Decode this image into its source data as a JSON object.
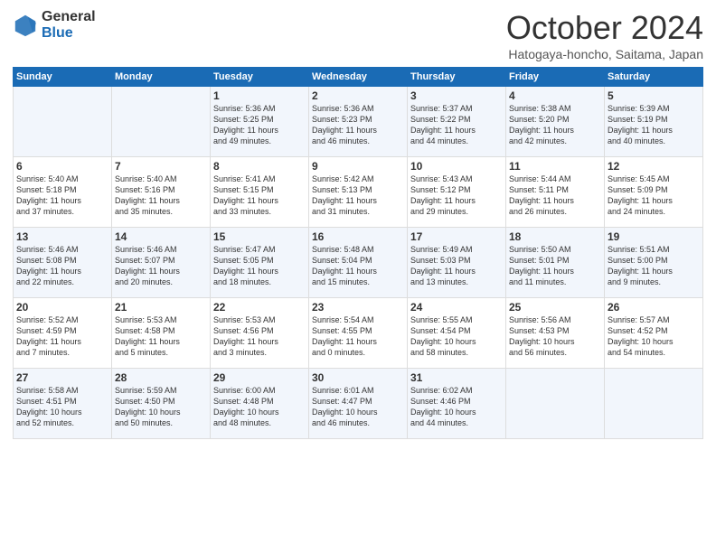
{
  "header": {
    "logo_general": "General",
    "logo_blue": "Blue",
    "title": "October 2024",
    "location": "Hatogaya-honcho, Saitama, Japan"
  },
  "days_of_week": [
    "Sunday",
    "Monday",
    "Tuesday",
    "Wednesday",
    "Thursday",
    "Friday",
    "Saturday"
  ],
  "weeks": [
    [
      {
        "day": "",
        "text": ""
      },
      {
        "day": "",
        "text": ""
      },
      {
        "day": "1",
        "text": "Sunrise: 5:36 AM\nSunset: 5:25 PM\nDaylight: 11 hours\nand 49 minutes."
      },
      {
        "day": "2",
        "text": "Sunrise: 5:36 AM\nSunset: 5:23 PM\nDaylight: 11 hours\nand 46 minutes."
      },
      {
        "day": "3",
        "text": "Sunrise: 5:37 AM\nSunset: 5:22 PM\nDaylight: 11 hours\nand 44 minutes."
      },
      {
        "day": "4",
        "text": "Sunrise: 5:38 AM\nSunset: 5:20 PM\nDaylight: 11 hours\nand 42 minutes."
      },
      {
        "day": "5",
        "text": "Sunrise: 5:39 AM\nSunset: 5:19 PM\nDaylight: 11 hours\nand 40 minutes."
      }
    ],
    [
      {
        "day": "6",
        "text": "Sunrise: 5:40 AM\nSunset: 5:18 PM\nDaylight: 11 hours\nand 37 minutes."
      },
      {
        "day": "7",
        "text": "Sunrise: 5:40 AM\nSunset: 5:16 PM\nDaylight: 11 hours\nand 35 minutes."
      },
      {
        "day": "8",
        "text": "Sunrise: 5:41 AM\nSunset: 5:15 PM\nDaylight: 11 hours\nand 33 minutes."
      },
      {
        "day": "9",
        "text": "Sunrise: 5:42 AM\nSunset: 5:13 PM\nDaylight: 11 hours\nand 31 minutes."
      },
      {
        "day": "10",
        "text": "Sunrise: 5:43 AM\nSunset: 5:12 PM\nDaylight: 11 hours\nand 29 minutes."
      },
      {
        "day": "11",
        "text": "Sunrise: 5:44 AM\nSunset: 5:11 PM\nDaylight: 11 hours\nand 26 minutes."
      },
      {
        "day": "12",
        "text": "Sunrise: 5:45 AM\nSunset: 5:09 PM\nDaylight: 11 hours\nand 24 minutes."
      }
    ],
    [
      {
        "day": "13",
        "text": "Sunrise: 5:46 AM\nSunset: 5:08 PM\nDaylight: 11 hours\nand 22 minutes."
      },
      {
        "day": "14",
        "text": "Sunrise: 5:46 AM\nSunset: 5:07 PM\nDaylight: 11 hours\nand 20 minutes."
      },
      {
        "day": "15",
        "text": "Sunrise: 5:47 AM\nSunset: 5:05 PM\nDaylight: 11 hours\nand 18 minutes."
      },
      {
        "day": "16",
        "text": "Sunrise: 5:48 AM\nSunset: 5:04 PM\nDaylight: 11 hours\nand 15 minutes."
      },
      {
        "day": "17",
        "text": "Sunrise: 5:49 AM\nSunset: 5:03 PM\nDaylight: 11 hours\nand 13 minutes."
      },
      {
        "day": "18",
        "text": "Sunrise: 5:50 AM\nSunset: 5:01 PM\nDaylight: 11 hours\nand 11 minutes."
      },
      {
        "day": "19",
        "text": "Sunrise: 5:51 AM\nSunset: 5:00 PM\nDaylight: 11 hours\nand 9 minutes."
      }
    ],
    [
      {
        "day": "20",
        "text": "Sunrise: 5:52 AM\nSunset: 4:59 PM\nDaylight: 11 hours\nand 7 minutes."
      },
      {
        "day": "21",
        "text": "Sunrise: 5:53 AM\nSunset: 4:58 PM\nDaylight: 11 hours\nand 5 minutes."
      },
      {
        "day": "22",
        "text": "Sunrise: 5:53 AM\nSunset: 4:56 PM\nDaylight: 11 hours\nand 3 minutes."
      },
      {
        "day": "23",
        "text": "Sunrise: 5:54 AM\nSunset: 4:55 PM\nDaylight: 11 hours\nand 0 minutes."
      },
      {
        "day": "24",
        "text": "Sunrise: 5:55 AM\nSunset: 4:54 PM\nDaylight: 10 hours\nand 58 minutes."
      },
      {
        "day": "25",
        "text": "Sunrise: 5:56 AM\nSunset: 4:53 PM\nDaylight: 10 hours\nand 56 minutes."
      },
      {
        "day": "26",
        "text": "Sunrise: 5:57 AM\nSunset: 4:52 PM\nDaylight: 10 hours\nand 54 minutes."
      }
    ],
    [
      {
        "day": "27",
        "text": "Sunrise: 5:58 AM\nSunset: 4:51 PM\nDaylight: 10 hours\nand 52 minutes."
      },
      {
        "day": "28",
        "text": "Sunrise: 5:59 AM\nSunset: 4:50 PM\nDaylight: 10 hours\nand 50 minutes."
      },
      {
        "day": "29",
        "text": "Sunrise: 6:00 AM\nSunset: 4:48 PM\nDaylight: 10 hours\nand 48 minutes."
      },
      {
        "day": "30",
        "text": "Sunrise: 6:01 AM\nSunset: 4:47 PM\nDaylight: 10 hours\nand 46 minutes."
      },
      {
        "day": "31",
        "text": "Sunrise: 6:02 AM\nSunset: 4:46 PM\nDaylight: 10 hours\nand 44 minutes."
      },
      {
        "day": "",
        "text": ""
      },
      {
        "day": "",
        "text": ""
      }
    ]
  ]
}
